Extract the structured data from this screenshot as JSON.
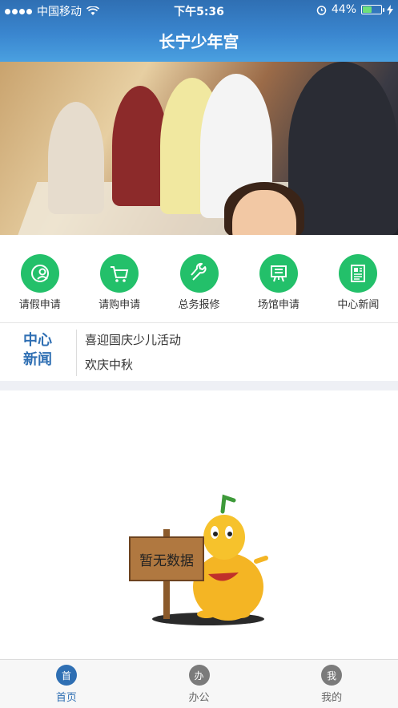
{
  "status_bar": {
    "carrier": "中国移动",
    "time": "下午5:36",
    "battery": "44%"
  },
  "header": {
    "title": "长宁少年宫"
  },
  "banner": {
    "slides": 3,
    "active_slide": 1
  },
  "menu": [
    {
      "label": "请假申请",
      "icon": "leave-request-icon"
    },
    {
      "label": "请购申请",
      "icon": "cart-icon"
    },
    {
      "label": "总务报修",
      "icon": "wrench-icon"
    },
    {
      "label": "场馆申请",
      "icon": "venue-icon"
    },
    {
      "label": "中心新闻",
      "icon": "newspaper-icon"
    }
  ],
  "news": {
    "tag_line1": "中心",
    "tag_line2": "新闻",
    "items": [
      "喜迎国庆少儿活动",
      "欢庆中秋"
    ]
  },
  "empty_state": {
    "sign_text": "暂无数据"
  },
  "tabs": [
    {
      "icon_text": "首",
      "label": "首页",
      "active": true
    },
    {
      "icon_text": "办",
      "label": "办公",
      "active": false
    },
    {
      "icon_text": "我",
      "label": "我的",
      "active": false
    }
  ],
  "colors": {
    "brand_blue": "#2f6fb3",
    "accent_green": "#23c06a",
    "battery_green": "#6ee07a"
  }
}
